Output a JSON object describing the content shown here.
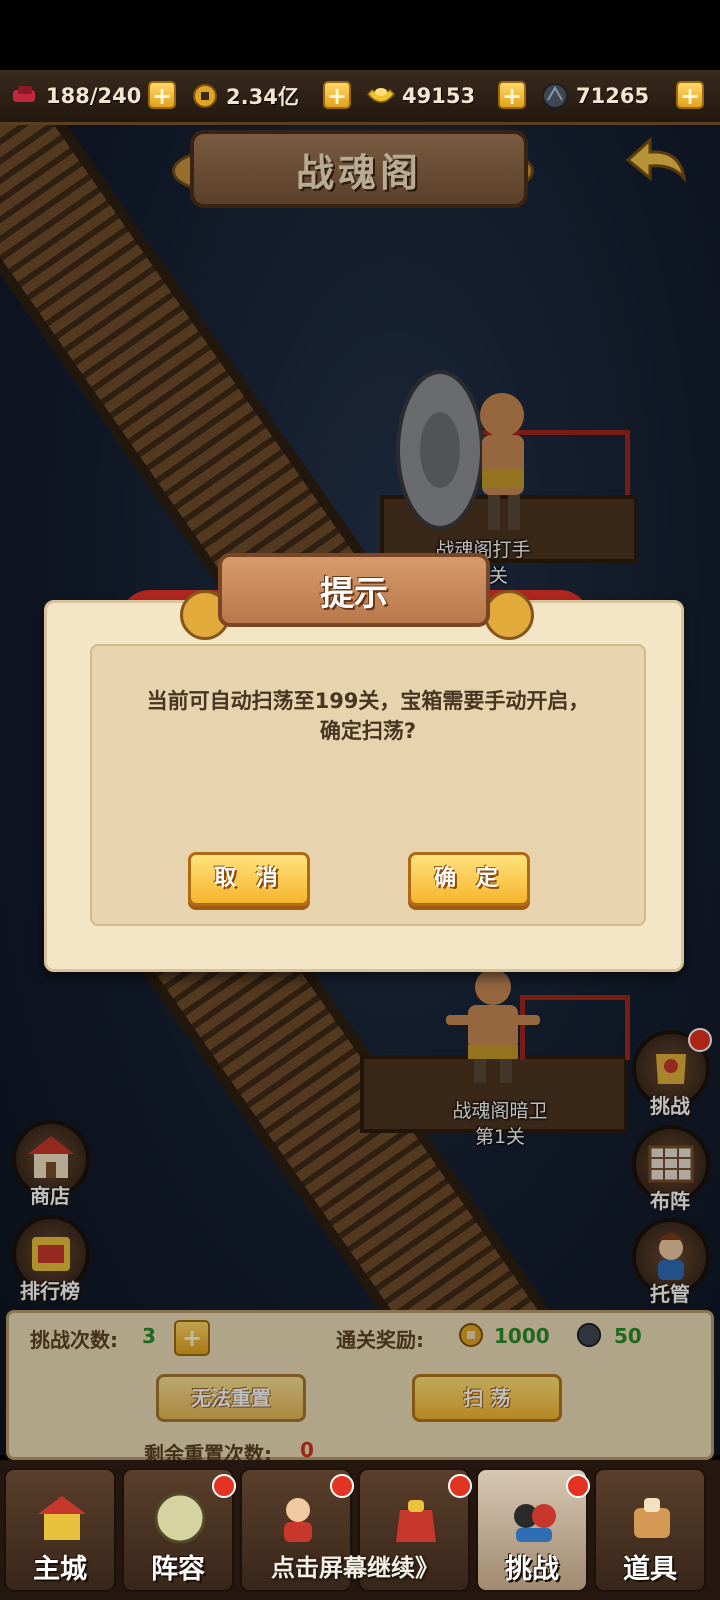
{
  "resources": [
    {
      "icon": "stamina-icon",
      "value": "188/240"
    },
    {
      "icon": "copper-coin-icon",
      "value": "2.34亿"
    },
    {
      "icon": "gold-ingot-icon",
      "value": "49153"
    },
    {
      "icon": "ore-icon",
      "value": "71265"
    }
  ],
  "scene": {
    "title": "战魂阁",
    "enemy_top": {
      "name": "战魂阁打手",
      "stage": "第2关"
    },
    "enemy_bottom": {
      "name": "战魂阁暗卫",
      "stage": "第1关"
    }
  },
  "side_left": [
    {
      "label": "商店",
      "icon": "shop-icon"
    },
    {
      "label": "排行榜",
      "icon": "ranking-icon"
    }
  ],
  "side_right": [
    {
      "label": "挑战",
      "icon": "challenge-icon"
    },
    {
      "label": "布阵",
      "icon": "formation-icon"
    },
    {
      "label": "托管",
      "icon": "auto-manage-icon"
    }
  ],
  "info_panel": {
    "challenge_count_label": "挑战次数:",
    "challenge_count": "3",
    "reward_label": "通关奖励:",
    "reward_coin": "1000",
    "reward_ore": "50",
    "reset_button": "无法重置",
    "sweep_button": "扫 荡",
    "reset_remaining_label": "剩余重置次数:",
    "reset_remaining": "0"
  },
  "bottom_nav": [
    {
      "label": "主城",
      "icon": "main-city-icon"
    },
    {
      "label": "阵容",
      "icon": "lineup-icon"
    },
    {
      "label": "",
      "icon": "hero-icon"
    },
    {
      "label": "",
      "icon": "bag-icon"
    },
    {
      "label": "挑战",
      "icon": "challenge-nav-icon"
    },
    {
      "label": "道具",
      "icon": "items-icon"
    }
  ],
  "continue_hint": "点击屏幕继续》",
  "dialog": {
    "title": "提示",
    "message_line1": "当前可自动扫荡至199关，宝箱需要手动开启，",
    "message_line2": "确定扫荡?",
    "cancel": "取 消",
    "confirm": "确 定"
  },
  "colors": {
    "dialog_bg": "#f3e6c6",
    "button_gold": "#f6b52e",
    "ribbon_red": "#b0271f"
  }
}
